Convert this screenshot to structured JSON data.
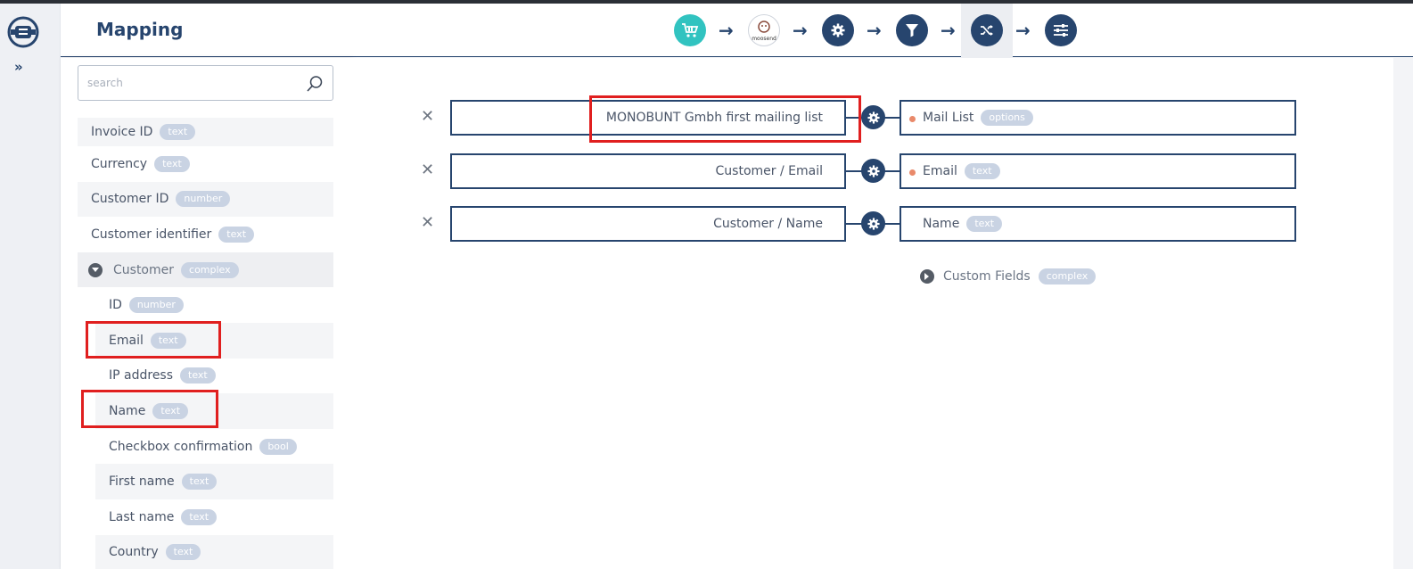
{
  "header": {
    "title": "Mapping"
  },
  "steps": [
    {
      "icon": "chart-cart-icon"
    },
    {
      "icon": "moosend-logo-icon",
      "text": "moosend"
    },
    {
      "icon": "gear-icon"
    },
    {
      "icon": "filter-icon"
    },
    {
      "icon": "shuffle-icon",
      "active": true
    },
    {
      "icon": "sliders-icon"
    }
  ],
  "search": {
    "placeholder": "search"
  },
  "fields": [
    {
      "label": "Invoice ID",
      "type": "text"
    },
    {
      "label": "Currency",
      "type": "text"
    },
    {
      "label": "Customer ID",
      "type": "number"
    },
    {
      "label": "Customer identifier",
      "type": "text"
    },
    {
      "label": "Customer",
      "type": "complex",
      "expanded": true
    },
    {
      "label": "ID",
      "type": "number"
    },
    {
      "label": "Email",
      "type": "text"
    },
    {
      "label": "IP address",
      "type": "text"
    },
    {
      "label": "Name",
      "type": "text"
    },
    {
      "label": "Checkbox confirmation",
      "type": "bool"
    },
    {
      "label": "First name",
      "type": "text"
    },
    {
      "label": "Last name",
      "type": "text"
    },
    {
      "label": "Country",
      "type": "text"
    }
  ],
  "mappings": [
    {
      "source": "MONOBUNT Gmbh first mailing list",
      "target": "Mail List",
      "target_type": "options",
      "required": true
    },
    {
      "source": "Customer / Email",
      "target": "Email",
      "target_type": "text",
      "required": true
    },
    {
      "source": "Customer / Name",
      "target": "Name",
      "target_type": "text",
      "required": false
    }
  ],
  "custom_fields": {
    "label": "Custom Fields",
    "type": "complex"
  },
  "colors": {
    "navy": "#27456e",
    "teal": "#31c3c0",
    "highlight": "#e01f1f",
    "required_dot": "#e9896a",
    "pill": "#c9d3e3"
  }
}
